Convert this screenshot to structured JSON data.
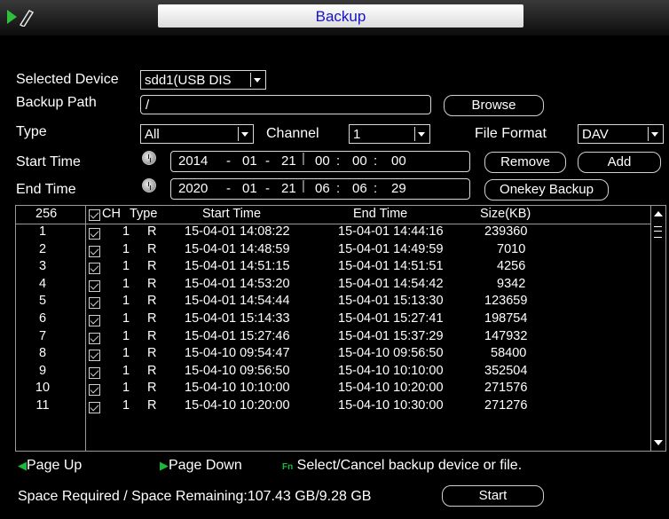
{
  "window": {
    "title": "Backup"
  },
  "form": {
    "selected_device_label": "Selected Device",
    "selected_device_value": "sdd1(USB DIS",
    "backup_path_label": "Backup Path",
    "backup_path_value": "/",
    "browse_label": "Browse",
    "type_label": "Type",
    "type_value": "All",
    "channel_label": "Channel",
    "channel_value": "1",
    "file_format_label": "File Format",
    "file_format_value": "DAV",
    "start_time_label": "Start Time",
    "start_time": {
      "year": "2014",
      "month": "01",
      "day": "21",
      "hour": "00",
      "minute": "00",
      "second": "00"
    },
    "end_time_label": "End Time",
    "end_time": {
      "year": "2020",
      "month": "01",
      "day": "21",
      "hour": "06",
      "minute": "06",
      "second": "29"
    },
    "remove_label": "Remove",
    "add_label": "Add",
    "onekey_label": "Onekey Backup",
    "date_sep": "-",
    "time_sep": ":"
  },
  "table": {
    "headers": {
      "count": "256",
      "ch": "CH",
      "type": "Type",
      "start": "Start Time",
      "end": "End Time",
      "size": "Size(KB)"
    },
    "rows": [
      {
        "idx": "1",
        "ch": "1",
        "type": "R",
        "start": "15-04-01 14:08:22",
        "end": "15-04-01 14:44:16",
        "size": "239360",
        "checked": true
      },
      {
        "idx": "2",
        "ch": "1",
        "type": "R",
        "start": "15-04-01 14:48:59",
        "end": "15-04-01 14:49:59",
        "size": "7010",
        "checked": true
      },
      {
        "idx": "3",
        "ch": "1",
        "type": "R",
        "start": "15-04-01 14:51:15",
        "end": "15-04-01 14:51:51",
        "size": "4256",
        "checked": true
      },
      {
        "idx": "4",
        "ch": "1",
        "type": "R",
        "start": "15-04-01 14:53:20",
        "end": "15-04-01 14:54:42",
        "size": "9342",
        "checked": true
      },
      {
        "idx": "5",
        "ch": "1",
        "type": "R",
        "start": "15-04-01 14:54:44",
        "end": "15-04-01 15:13:30",
        "size": "123659",
        "checked": true
      },
      {
        "idx": "6",
        "ch": "1",
        "type": "R",
        "start": "15-04-01 15:14:33",
        "end": "15-04-01 15:27:41",
        "size": "198754",
        "checked": true
      },
      {
        "idx": "7",
        "ch": "1",
        "type": "R",
        "start": "15-04-01 15:27:46",
        "end": "15-04-01 15:37:29",
        "size": "147932",
        "checked": true
      },
      {
        "idx": "8",
        "ch": "1",
        "type": "R",
        "start": "15-04-10 09:54:47",
        "end": "15-04-10 09:56:50",
        "size": "58400",
        "checked": true
      },
      {
        "idx": "9",
        "ch": "1",
        "type": "R",
        "start": "15-04-10 09:56:50",
        "end": "15-04-10 10:10:00",
        "size": "352504",
        "checked": true
      },
      {
        "idx": "10",
        "ch": "1",
        "type": "R",
        "start": "15-04-10 10:10:00",
        "end": "15-04-10 10:20:00",
        "size": "271576",
        "checked": true
      },
      {
        "idx": "11",
        "ch": "1",
        "type": "R",
        "start": "15-04-10 10:20:00",
        "end": "15-04-10 10:30:00",
        "size": "271276",
        "checked": true
      }
    ]
  },
  "hints": {
    "page_up": "Page Up",
    "page_down": "Page Down",
    "fn_badge": "Fn",
    "fn_text": "Select/Cancel backup device or file."
  },
  "footer": {
    "space_text": "Space Required / Space Remaining:107.43 GB/9.28 GB",
    "start_label": "Start"
  },
  "colors": {
    "title_text": "#1414c8",
    "accent_green": "#19b93a",
    "background": "#000000"
  },
  "icons": {
    "logo": "play-pen-logo-icon",
    "clock": "clock-icon",
    "page_up": "page-up-icon",
    "page_down": "page-down-icon"
  }
}
